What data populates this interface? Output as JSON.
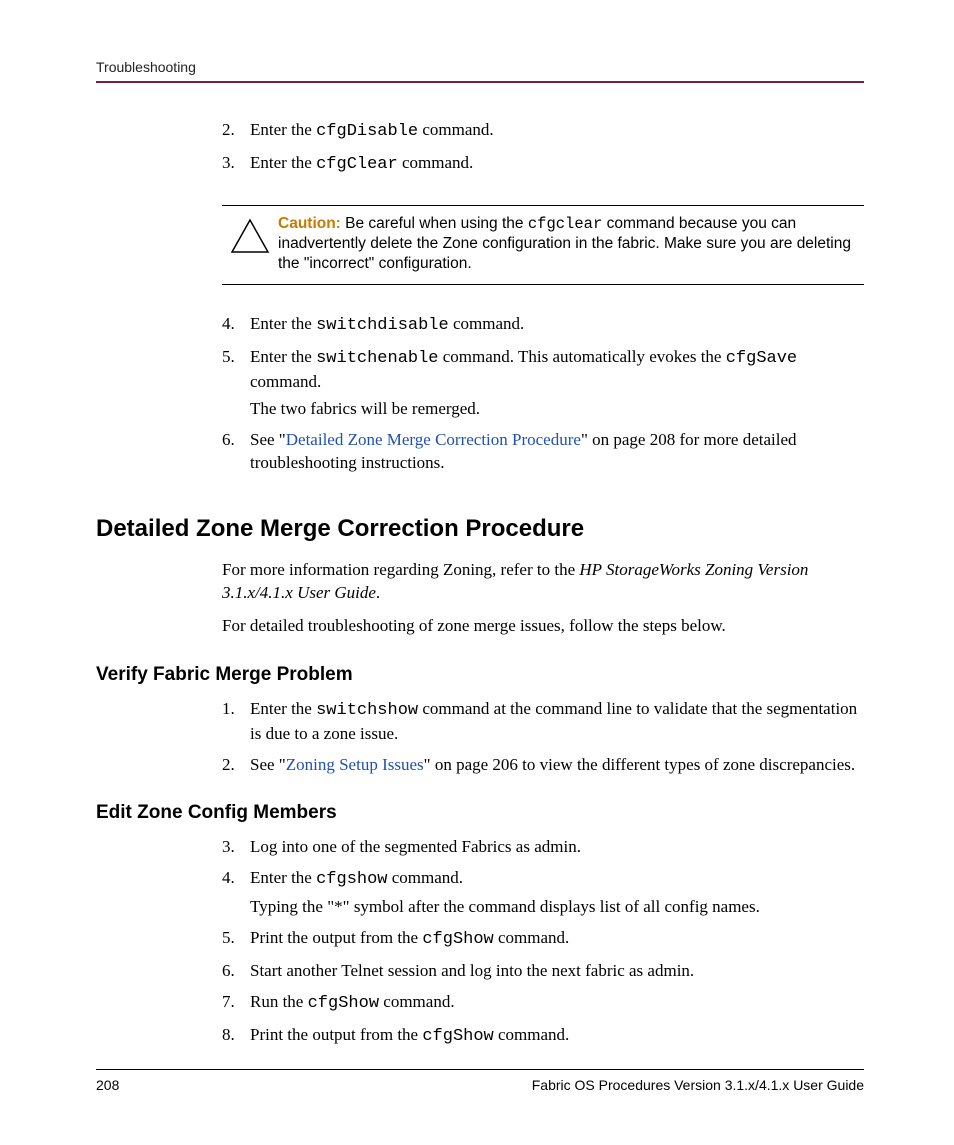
{
  "running_head": "Troubleshooting",
  "steps_a": [
    {
      "n": "2.",
      "pre": "Enter the ",
      "cmd": "cfgDisable",
      "post": " command."
    },
    {
      "n": "3.",
      "pre": "Enter the ",
      "cmd": "cfgClear",
      "post": " command."
    }
  ],
  "caution": {
    "label": "Caution:",
    "t1": "  Be careful when using the ",
    "cmd": "cfgclear",
    "t2": " command because you can inadvertently delete the Zone configuration in the fabric. Make sure you are deleting the \"incorrect\" configuration."
  },
  "steps_b": {
    "i4": {
      "n": "4.",
      "pre": "Enter the ",
      "cmd": "switchdisable",
      "post": " command."
    },
    "i5": {
      "n": "5.",
      "pre": "Enter the ",
      "cmd1": "switchenable",
      "mid": " command. This automatically evokes the ",
      "cmd2": "cfgSave",
      "post": " command.",
      "sub": "The two fabrics will be remerged."
    },
    "i6": {
      "n": "6.",
      "pre": "See \"",
      "link": "Detailed Zone Merge Correction Procedure",
      "post": "\" on page 208 for more detailed troubleshooting instructions."
    }
  },
  "h1": "Detailed Zone Merge Correction Procedure",
  "p1": {
    "a": "For more information regarding Zoning, refer to the ",
    "ital": "HP StorageWorks Zoning Version 3.1.x/4.1.x User Guide",
    "b": "."
  },
  "p2": "For detailed troubleshooting of zone merge issues, follow the steps below.",
  "h2a": "Verify Fabric Merge Problem",
  "verify": {
    "i1": {
      "n": "1.",
      "pre": "Enter the ",
      "cmd": "switchshow",
      "post": " command at the command line to validate that the segmentation is due to a zone issue."
    },
    "i2": {
      "n": "2.",
      "pre": "See \"",
      "link": "Zoning Setup Issues",
      "post": "\" on page 206 to view the different types of zone discrepancies."
    }
  },
  "h2b": "Edit Zone Config Members",
  "edit": {
    "i3": {
      "n": "3.",
      "txt": "Log into one of the segmented Fabrics as admin."
    },
    "i4": {
      "n": "4.",
      "pre": "Enter the ",
      "cmd": "cfgshow",
      "post": " command.",
      "sub": "Typing the \"*\" symbol after the command displays list of all config names."
    },
    "i5": {
      "n": "5.",
      "pre": "Print the output from the ",
      "cmd": "cfgShow",
      "post": " command."
    },
    "i6": {
      "n": "6.",
      "txt": "Start another Telnet session and log into the next fabric as admin."
    },
    "i7": {
      "n": "7.",
      "pre": "Run the ",
      "cmd": "cfgShow",
      "post": " command."
    },
    "i8": {
      "n": "8.",
      "pre": "Print the output from the ",
      "cmd": "cfgShow",
      "post": " command."
    }
  },
  "footer": {
    "page": "208",
    "title": "Fabric OS Procedures Version 3.1.x/4.1.x User Guide"
  }
}
